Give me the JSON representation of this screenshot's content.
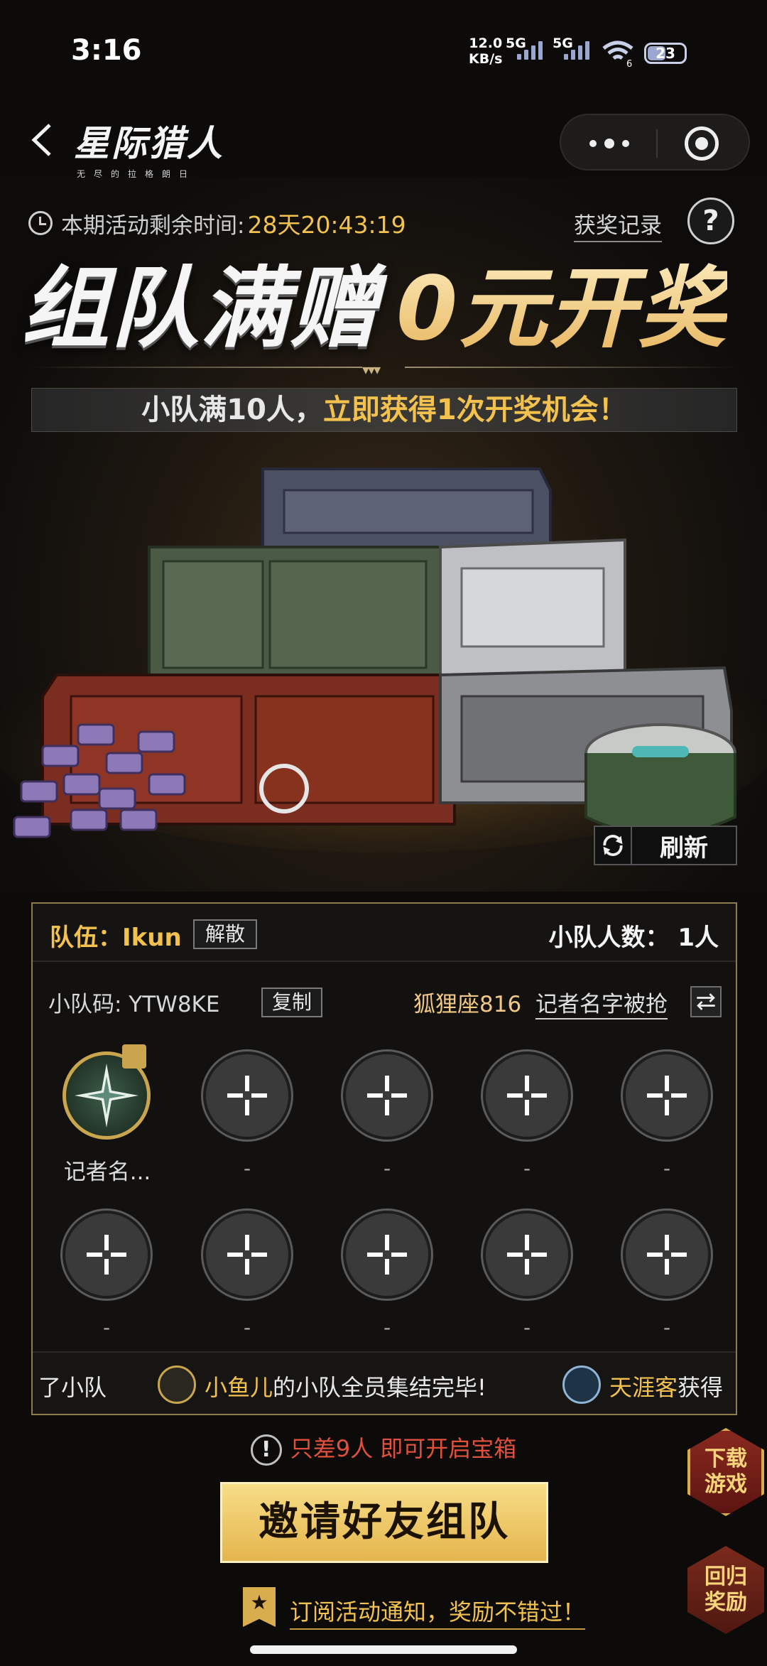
{
  "status_bar": {
    "time": "3:16",
    "net_speed_value": "12.0",
    "net_speed_unit": "KB/s",
    "sim1_label": "5G",
    "sim2_label": "5G",
    "wifi_label": "6",
    "battery": "23"
  },
  "header": {
    "brand_name": "星际猎人",
    "brand_sub": "无尽的拉格朗日"
  },
  "banner": {
    "timer_label": "本期活动剩余时间:",
    "timer_value": "28天20:43:19",
    "record_link": "获奖记录",
    "help": "?",
    "headline_left": "组队满赠",
    "headline_right": "0元开奖",
    "sub_prefix": "小队满10人，",
    "sub_highlight": "立即获得1次开奖机会！",
    "refresh_label": "刷新"
  },
  "team": {
    "team_label": "队伍：Ikun",
    "dissolve_label": "解散",
    "count_label": "小队人数： 1人",
    "code_label": "小队码: YTW8KE",
    "copy_label": "复制",
    "user_sign": "狐狸座816",
    "user_nick": "记者名字被抢",
    "leader_name": "记者名...",
    "empty_placeholder": "-",
    "ticker": {
      "seg1": "了小队",
      "seg2_name": "小鱼儿",
      "seg2_text": "的小队全员集结完毕!",
      "seg3_name": "天涯客",
      "seg3_text": "获得"
    }
  },
  "bottom": {
    "warn_text": "只差9人 即可开启宝箱",
    "warn_icon": "!",
    "invite_label": "邀请好友组队",
    "subscribe_label": "订阅活动通知，奖励不错过！",
    "download_label_1": "下载",
    "download_label_2": "游戏",
    "return_label_1": "回归",
    "return_label_2": "奖励"
  },
  "colors": {
    "accent_gold": "#f2c14e",
    "warn_red": "#e0503c",
    "panel_border": "#8e7b4c"
  }
}
